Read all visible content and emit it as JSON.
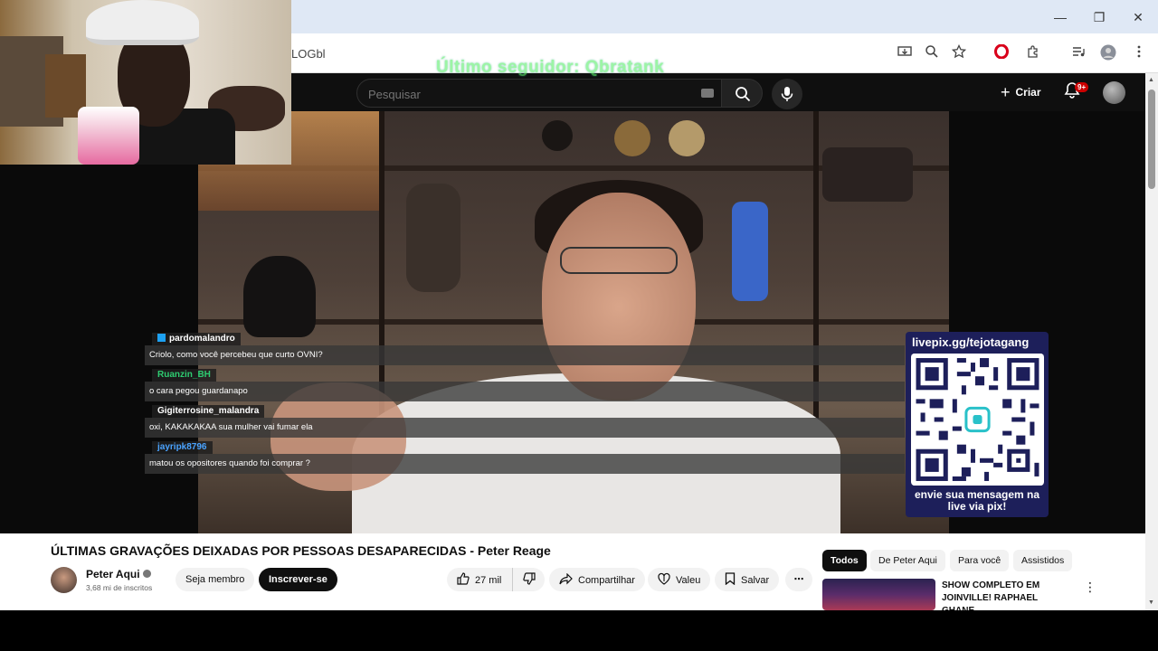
{
  "window": {
    "minimize": "—",
    "restore": "❐",
    "close": "✕"
  },
  "browser": {
    "url_partial": "LOGbl",
    "toolbar_icons": [
      "install-icon",
      "zoom-icon",
      "star-icon",
      "opera-icon",
      "extensions-icon",
      "media-icon",
      "profile-icon",
      "menu-icon"
    ]
  },
  "stream_overlay": {
    "follower_text": "Último seguidor: Qbratank"
  },
  "youtube_header": {
    "search_placeholder": "Pesquisar",
    "create_label": "Criar",
    "notification_badge": "9+"
  },
  "chat": [
    {
      "user": "pardomalandro",
      "user_color": "#ffffff",
      "message": "Criolo, como você percebeu que curto OVNI?",
      "has_icon": true
    },
    {
      "user": "Ruanzin_BH",
      "user_color": "#2ecc71",
      "message": "o cara pegou guardanapo",
      "has_icon": false
    },
    {
      "user": "Gigiterrosine_malandra",
      "user_color": "#ffffff",
      "message": "oxi, KAKAKAKAA sua mulher vai fumar ela",
      "has_icon": false
    },
    {
      "user": "jayripk8796",
      "user_color": "#4aa3ff",
      "message": "matou os opositores quando foi comprar ?",
      "has_icon": false
    }
  ],
  "qr_card": {
    "header": "livepix.gg/tejotagang",
    "footer": "envie sua mensagem na live via pix!",
    "bg_color": "#1d1f5a"
  },
  "video": {
    "title": "ÚLTIMAS GRAVAÇÕES DEIXADAS POR PESSOAS DESAPARECIDAS - Peter Reage",
    "channel_name": "Peter Aqui",
    "subscribers": "3,68 mi de inscritos",
    "member_label": "Seja membro",
    "subscribe_label": "Inscrever-se",
    "likes": "27 mil",
    "share_label": "Compartilhar",
    "thanks_label": "Valeu",
    "save_label": "Salvar",
    "more": "⋯"
  },
  "recommendations": {
    "chips": [
      "Todos",
      "De Peter Aqui",
      "Para você",
      "Assistidos"
    ],
    "first_title": "SHOW COMPLETO EM JOINVILLE! RAPHAEL GHANE..."
  }
}
